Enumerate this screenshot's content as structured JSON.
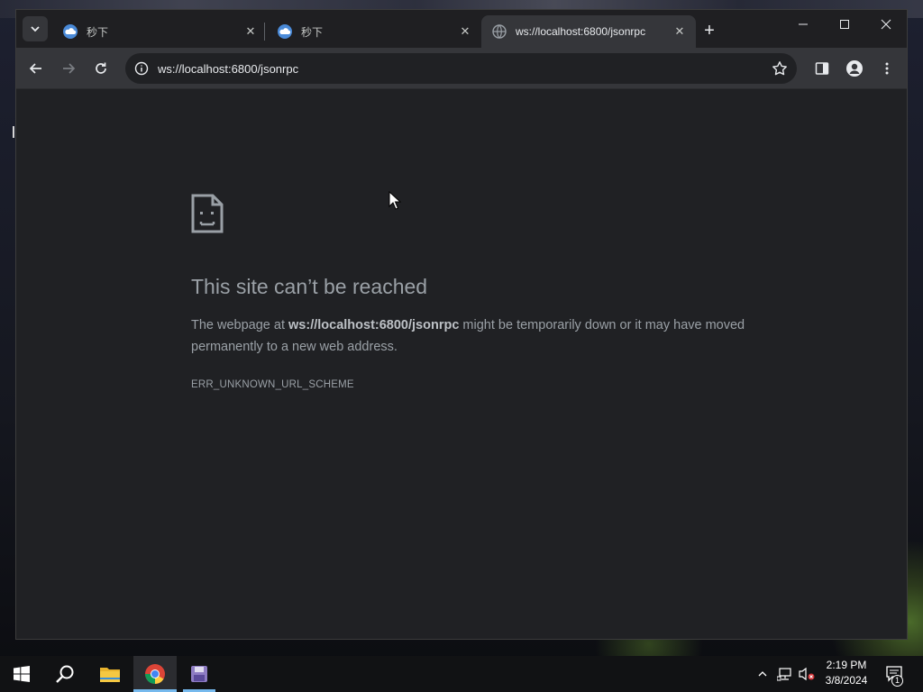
{
  "browser": {
    "tabs": [
      {
        "title": "秒下",
        "active": false
      },
      {
        "title": "秒下",
        "active": false
      },
      {
        "title": "ws://localhost:6800/jsonrpc",
        "active": true
      }
    ],
    "omnibox": {
      "url": "ws://localhost:6800/jsonrpc"
    }
  },
  "error_page": {
    "title": "This site can’t be reached",
    "desc_prefix": "The webpage at ",
    "desc_url": "ws://localhost:6800/jsonrpc",
    "desc_suffix": " might be temporarily down or it may have moved permanently to a new web address.",
    "code": "ERR_UNKNOWN_URL_SCHEME"
  },
  "taskbar": {
    "clock_time": "2:19 PM",
    "clock_date": "3/8/2024",
    "notification_count": "1"
  },
  "colors": {
    "accent": "#76b9ed",
    "page_bg": "#202124",
    "toolbar_bg": "#35363a"
  },
  "icons": {
    "tab_favicon": "cloud-icon",
    "active_tab_favicon": "globe-icon",
    "error": "sad-document-icon"
  }
}
